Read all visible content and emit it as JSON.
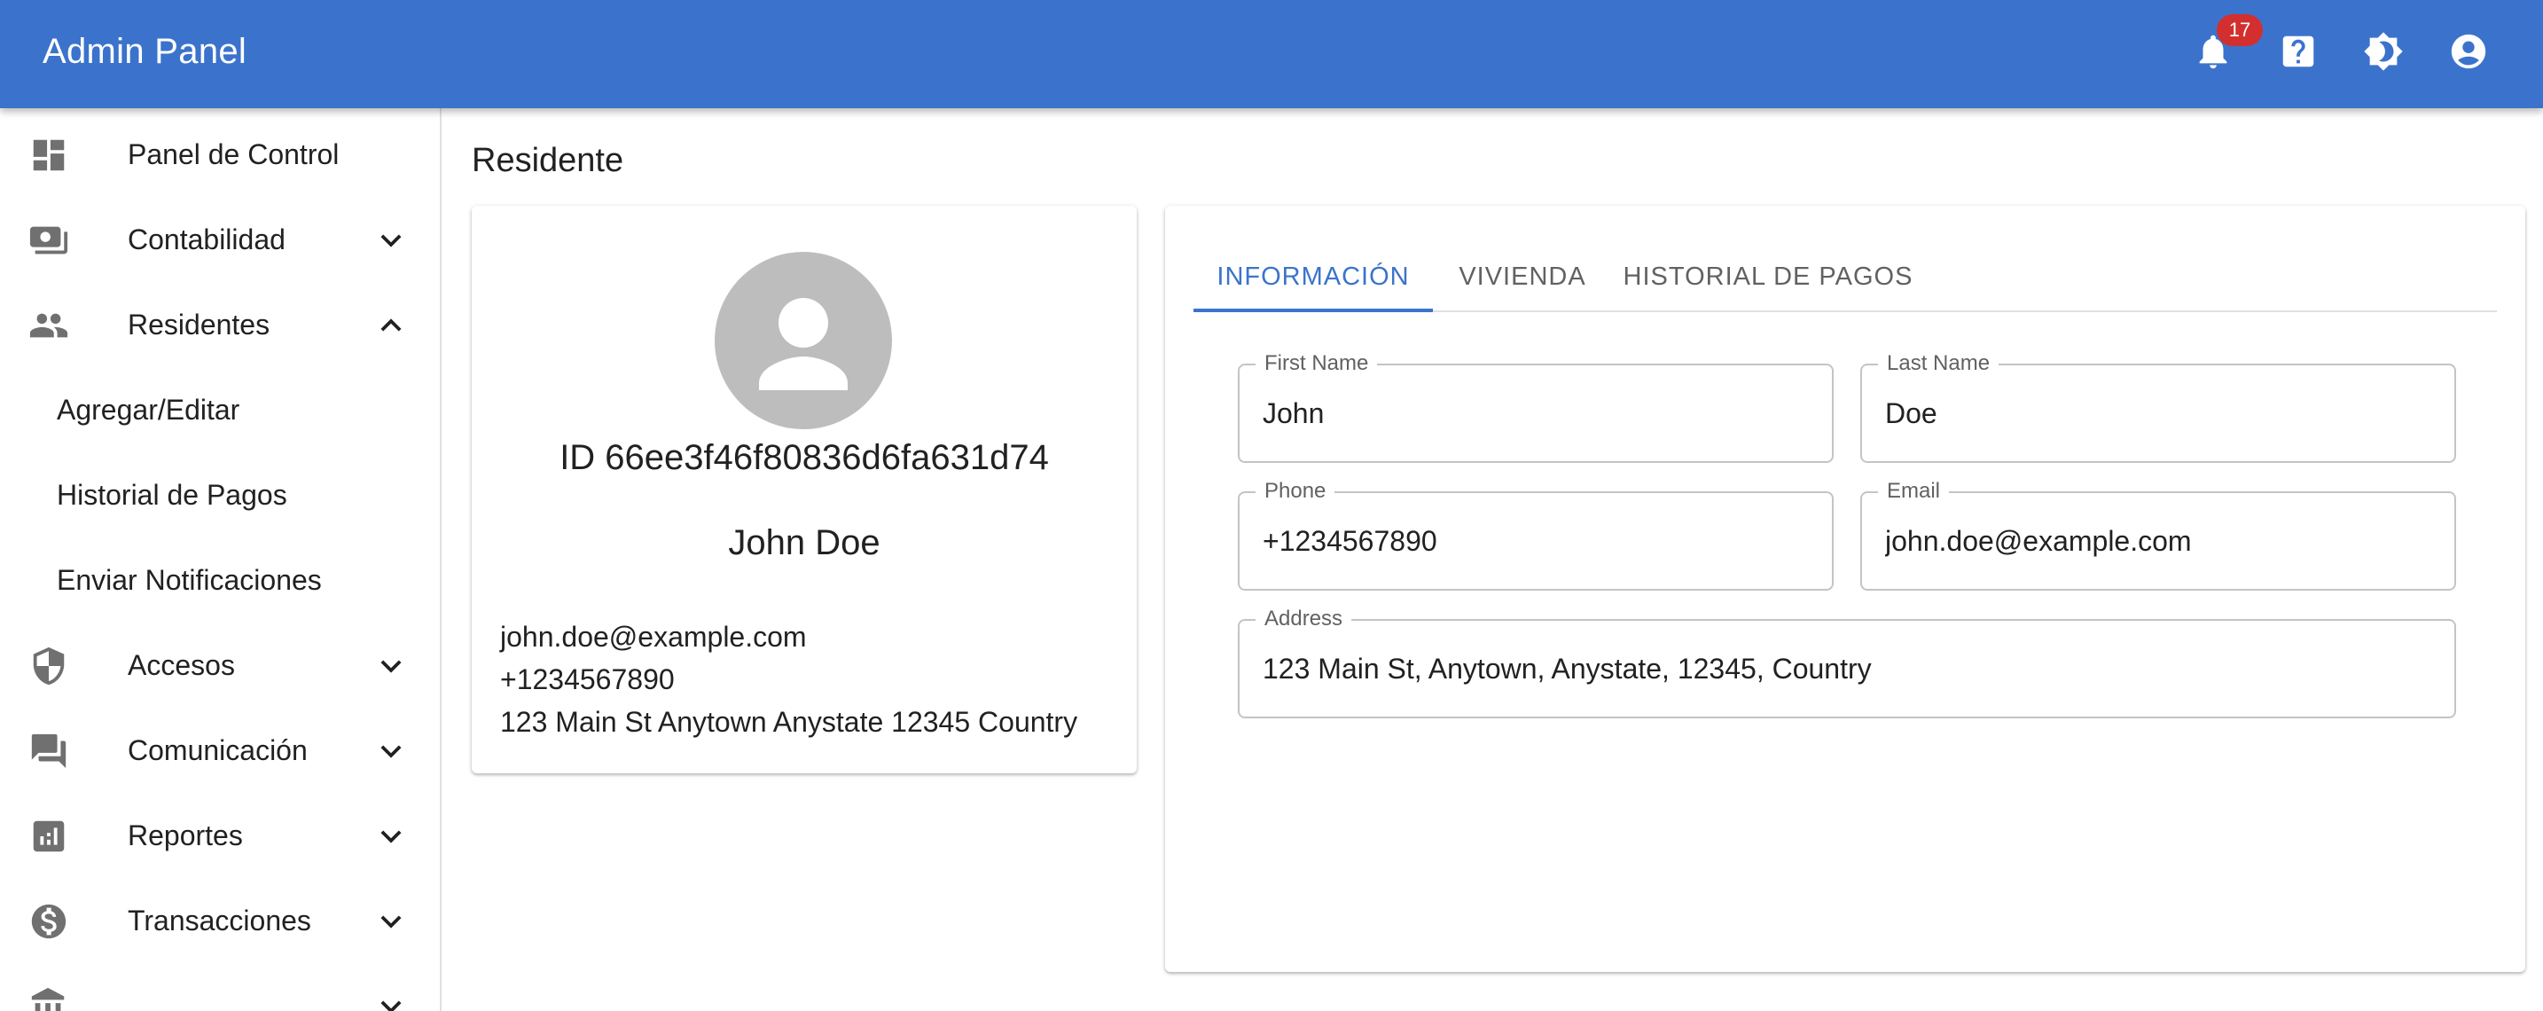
{
  "appbar": {
    "title": "Admin Panel",
    "notification_count": "17",
    "icons": [
      "bell-icon",
      "help-icon",
      "brightness-icon",
      "account-circle-icon"
    ],
    "color": "#3b73cc"
  },
  "sidebar": {
    "items": [
      {
        "label": "Panel de Control",
        "icon": "dashboard-icon"
      },
      {
        "label": "Contabilidad",
        "icon": "payments-icon",
        "chevron": "down"
      },
      {
        "label": "Residentes",
        "icon": "people-icon",
        "chevron": "up"
      },
      {
        "label": "Accesos",
        "icon": "shield-icon",
        "chevron": "down"
      },
      {
        "label": "Comunicación",
        "icon": "forum-icon",
        "chevron": "down"
      },
      {
        "label": "Reportes",
        "icon": "analytics-icon",
        "chevron": "down"
      },
      {
        "label": "Transacciones",
        "icon": "dollar-icon",
        "chevron": "down"
      }
    ],
    "subitems": [
      {
        "label": "Agregar/Editar"
      },
      {
        "label": "Historial de Pagos"
      },
      {
        "label": "Enviar Notificaciones"
      }
    ]
  },
  "page": {
    "title": "Residente"
  },
  "profile": {
    "id_text": "ID 66ee3f46f80836d6fa631d74",
    "name": "John Doe",
    "email": "john.doe@example.com",
    "phone": "+1234567890",
    "address": "123 Main St Anytown Anystate 12345 Country"
  },
  "tabs": [
    {
      "label": "INFORMACIÓN",
      "active": true
    },
    {
      "label": "VIVIENDA",
      "active": false
    },
    {
      "label": "HISTORIAL DE PAGOS",
      "active": false
    }
  ],
  "form": {
    "first_name": {
      "label": "First Name",
      "value": "John"
    },
    "last_name": {
      "label": "Last Name",
      "value": "Doe"
    },
    "phone": {
      "label": "Phone",
      "value": "+1234567890"
    },
    "email": {
      "label": "Email",
      "value": "john.doe@example.com"
    },
    "address": {
      "label": "Address",
      "value": "123 Main St, Anytown, Anystate, 12345, Country"
    }
  }
}
